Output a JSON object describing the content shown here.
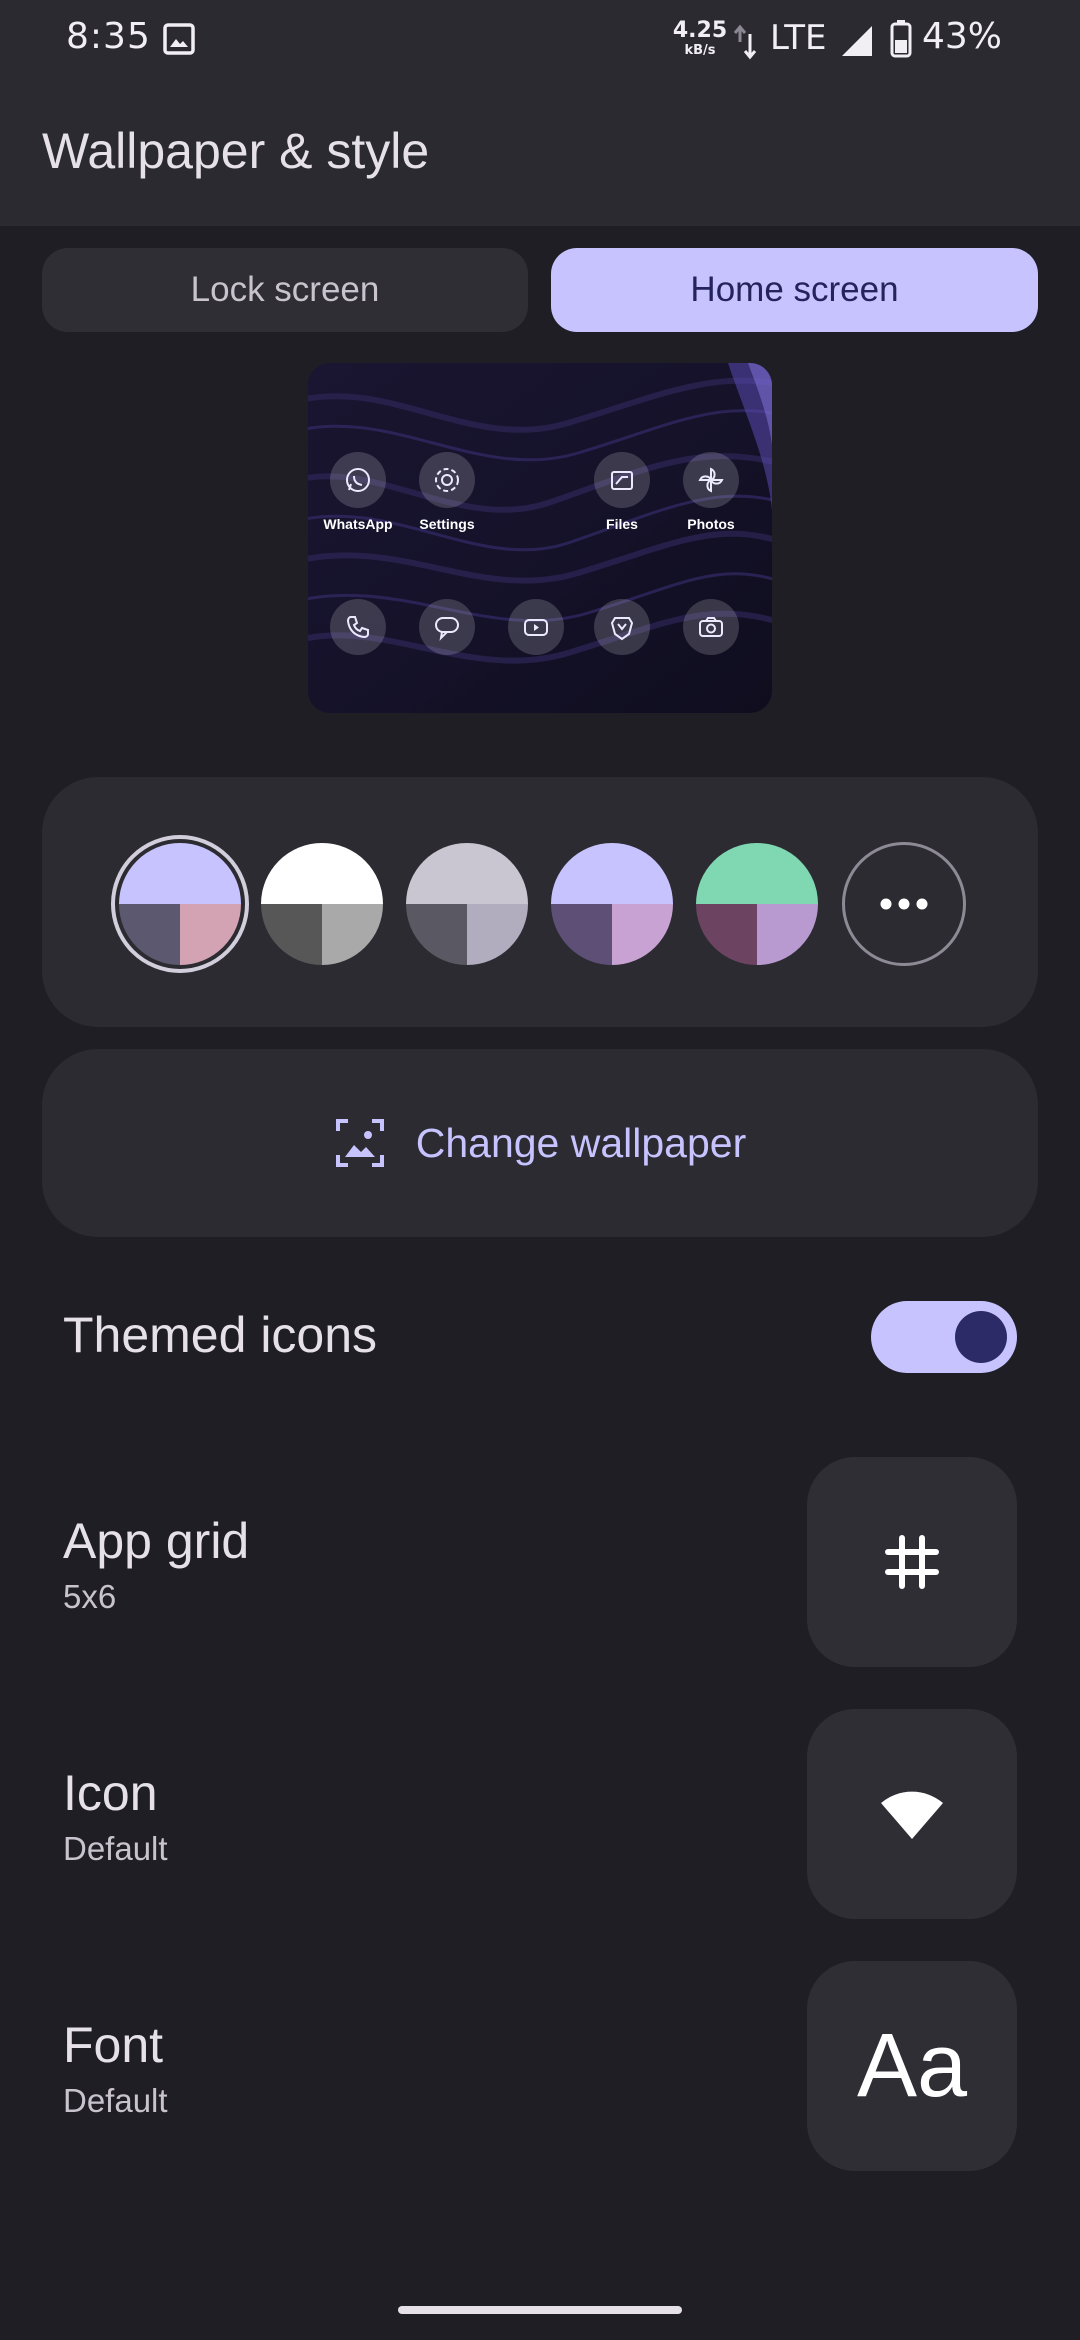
{
  "status_bar": {
    "time": "8:35",
    "net_speed_value": "4.25",
    "net_speed_unit": "kB/s",
    "network": "LTE",
    "battery": "43%"
  },
  "header": {
    "title": "Wallpaper & style"
  },
  "tabs": [
    {
      "label": "Lock screen",
      "selected": false
    },
    {
      "label": "Home screen",
      "selected": true
    }
  ],
  "preview": {
    "top_apps": [
      {
        "label": "WhatsApp",
        "icon": "whatsapp-icon"
      },
      {
        "label": "Settings",
        "icon": "settings-gear-icon"
      },
      {
        "label": "Files",
        "icon": "files-icon"
      },
      {
        "label": "Photos",
        "icon": "photos-pinwheel-icon"
      }
    ],
    "dock_icons": [
      "phone-icon",
      "messages-icon",
      "youtube-icon",
      "brave-icon",
      "camera-icon"
    ]
  },
  "colors": {
    "selected_index": 0,
    "swatches": [
      {
        "top": "#c7c3ff",
        "bottom_left": "#5b5870",
        "bottom_right": "#d3a3b3"
      },
      {
        "top": "#ffffff",
        "bottom_left": "#575757",
        "bottom_right": "#a9a9a9"
      },
      {
        "top": "#c9c5d1",
        "bottom_left": "#5a5863",
        "bottom_right": "#b1acbe"
      },
      {
        "top": "#c7c3ff",
        "bottom_left": "#5e4f77",
        "bottom_right": "#c9a2d4"
      },
      {
        "top": "#80d8b3",
        "bottom_left": "#6c4461",
        "bottom_right": "#b89ad0"
      }
    ],
    "more_icon": "more-horiz-icon"
  },
  "change_wallpaper": {
    "label": "Change wallpaper",
    "icon": "wallpaper-icon"
  },
  "themed_icons": {
    "title": "Themed icons",
    "enabled": true
  },
  "app_grid": {
    "title": "App grid",
    "value": "5x6",
    "icon": "grid-hash-icon"
  },
  "icon_style": {
    "title": "Icon",
    "value": "Default",
    "icon": "wifi-shape-icon"
  },
  "font": {
    "title": "Font",
    "value": "Default",
    "sample": "Aa"
  },
  "theme": {
    "background": "#1f1e24",
    "surface": "#2c2b31",
    "accent": "#c7c3ff",
    "accent_dark": "#2d2b67"
  }
}
